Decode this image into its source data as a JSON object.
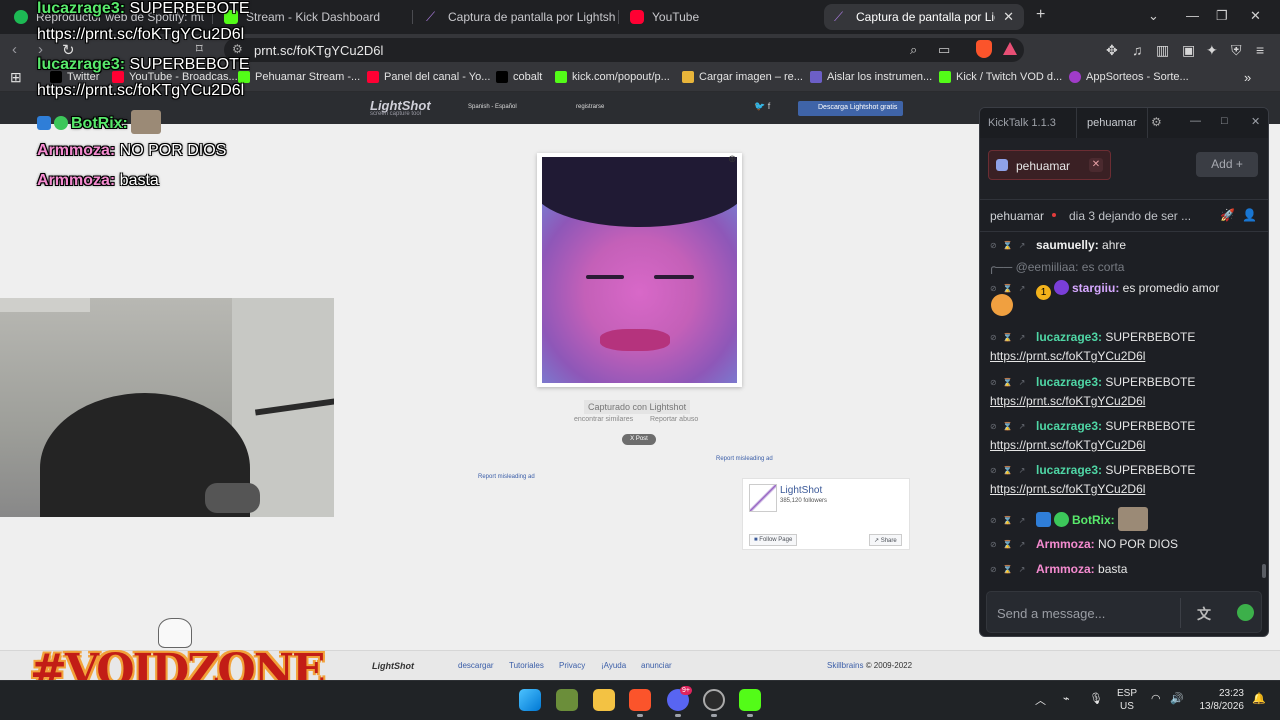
{
  "browser": {
    "tabs": [
      {
        "label": "Reproductor web de Spotify: music f",
        "color": "#1db954"
      },
      {
        "label": "Stream - Kick Dashboard",
        "color": "#53fc18"
      },
      {
        "label": "Captura de pantalla por Lightshot",
        "color": "#8f5bbf"
      },
      {
        "label": "YouTube",
        "color": "#ff0033"
      },
      {
        "label": "Captura de pantalla por Lightshot",
        "color": "#8f5bbf",
        "close": "✕"
      }
    ],
    "new_tab": "+",
    "url": "prnt.sc/foKTgYCu2D6l",
    "bookmarks": [
      {
        "label": "Twitter"
      },
      {
        "label": "YouTube - Broadcas..."
      },
      {
        "label": "Pehuamar Stream -..."
      },
      {
        "label": "Panel del canal - Yo..."
      },
      {
        "label": "cobalt"
      },
      {
        "label": "kick.com/popout/p..."
      },
      {
        "label": "Cargar imagen – re..."
      },
      {
        "label": "Aislar los instrumen..."
      },
      {
        "label": "Kick / Twitch VOD d..."
      },
      {
        "label": "AppSorteos - Sorte..."
      }
    ],
    "more_bookmarks": "»"
  },
  "lightshot": {
    "logo": "LightShot",
    "logo_sub": "screen capture tool",
    "language": "Spanish - Español",
    "register": "registrarse",
    "download": "Descarga Lightshot gratis",
    "captured_with": "Capturado con Lightshot",
    "find_similar": "encontrar similares",
    "report_abuse": "Reportar abuso",
    "x_post": "X Post",
    "misleading_ad": "Report misleading ad",
    "fb": {
      "name": "LightShot",
      "followers": "385,120 followers",
      "follow": "Follow Page",
      "share": "Share"
    },
    "footer": {
      "logo": "LightShot",
      "links": [
        "descargar",
        "Tutoriales",
        "Privacy",
        "¡Ayuda",
        "anunciar"
      ],
      "brand": "Skillbrains",
      "copyright": " © 2009-2022"
    }
  },
  "overlay": {
    "messages": [
      {
        "user": "lucazrage3:",
        "text": " SUPERBEBOTE"
      },
      {
        "link": "https://prnt.sc/foKTgYCu2D6l"
      },
      {
        "user": "lucazrage3:",
        "text": " SUPERBEBOTE"
      },
      {
        "link": "https://prnt.sc/foKTgYCu2D6l"
      },
      {
        "user": "BotRix:",
        "text": ""
      },
      {
        "user": "Armmoza:",
        "text": " NO POR DIOS"
      },
      {
        "user": "Armmoza:",
        "text": " basta"
      }
    ],
    "logo": "#VOIDZONE"
  },
  "kicktalk": {
    "app": "KickTalk 1.1.3",
    "user": "pehuamar",
    "channel": "pehuamar",
    "channel_close": "✕",
    "add": "Add  +",
    "streamer": "pehuamar",
    "stream_title": "dia 3 dejando de ser ...",
    "reply_to": "╭── @eemiiliaa: es corta",
    "messages": [
      {
        "user": "saumuelly:",
        "text": " ahre"
      },
      {
        "user": "stargiiu:",
        "text": " es promedio amor"
      },
      {
        "user": "lucazrage3:",
        "text": " SUPERBEBOTE",
        "link": "https://prnt.sc/foKTgYCu2D6l"
      },
      {
        "user": "lucazrage3:",
        "text": " SUPERBEBOTE",
        "link": "https://prnt.sc/foKTgYCu2D6l"
      },
      {
        "user": "lucazrage3:",
        "text": " SUPERBEBOTE",
        "link": "https://prnt.sc/foKTgYCu2D6l"
      },
      {
        "user": "lucazrage3:",
        "text": " SUPERBEBOTE",
        "link": "https://prnt.sc/foKTgYCu2D6l"
      },
      {
        "user": "BotRix:",
        "text": ""
      },
      {
        "user": "Armmoza:",
        "text": " NO POR DIOS"
      },
      {
        "user": "Armmoza:",
        "text": " basta"
      }
    ],
    "stargiiu_badge": "1",
    "input_placeholder": "Send a message..."
  },
  "taskbar": {
    "lang": "ESP",
    "region": "US",
    "time": "23:23",
    "date": "13/8/2026",
    "discord_badge": "9+"
  },
  "colors": {
    "kick_green": "#53fc18",
    "lightshot_purple": "#8f5bbf",
    "chat_teal": "#4fd6a5",
    "chat_pink": "#f58bd0"
  }
}
